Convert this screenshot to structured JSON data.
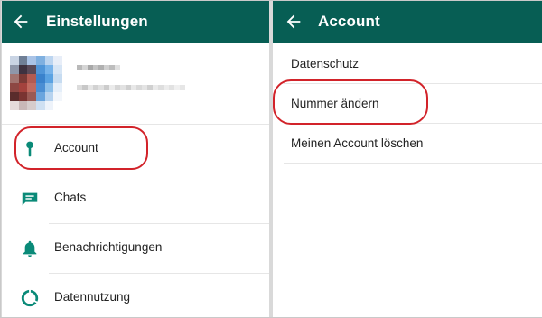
{
  "left_screen": {
    "title": "Einstellungen",
    "back_icon": "arrow-left-icon",
    "profile": {
      "avatar": "pixelated-avatar"
    },
    "items": [
      {
        "label": "Account",
        "icon": "key-icon"
      },
      {
        "label": "Chats",
        "icon": "chat-icon"
      },
      {
        "label": "Benachrichtigungen",
        "icon": "bell-icon"
      },
      {
        "label": "Datennutzung",
        "icon": "data-usage-icon"
      }
    ]
  },
  "right_screen": {
    "title": "Account",
    "back_icon": "arrow-left-icon",
    "items": [
      {
        "label": "Datenschutz"
      },
      {
        "label": "Nummer ändern"
      },
      {
        "label": "Meinen Account löschen"
      }
    ]
  },
  "colors": {
    "appbar": "#075e54",
    "icon_teal": "#0a8a78",
    "highlight_red": "#d2232a"
  }
}
